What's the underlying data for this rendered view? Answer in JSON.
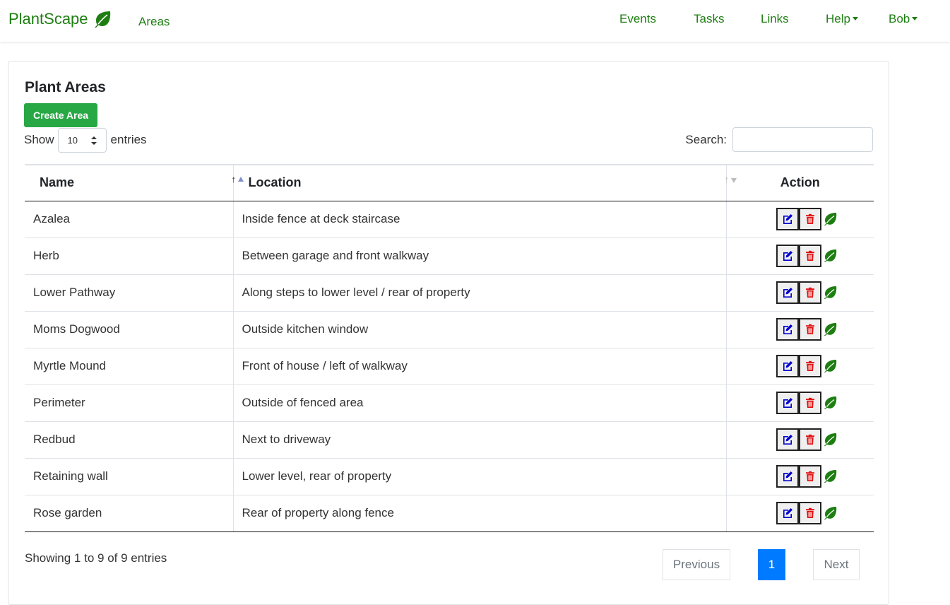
{
  "navbar": {
    "brand": "PlantScape",
    "areas": "Areas",
    "events": "Events",
    "tasks": "Tasks",
    "links": "Links",
    "help": "Help",
    "user": "Bob",
    "color": "#1e7e12"
  },
  "card": {
    "title": "Plant Areas",
    "create_button": "Create Area"
  },
  "length_menu": {
    "show": "Show",
    "value": "10",
    "entries": "entries"
  },
  "search": {
    "label": "Search:",
    "value": ""
  },
  "table": {
    "columns": [
      "Name",
      "Location",
      "Action"
    ],
    "sorted_column": "Name",
    "sort_direction": "ascending",
    "rows": [
      {
        "name": "Azalea",
        "location": "Inside fence at deck staircase"
      },
      {
        "name": "Herb",
        "location": "Between garage and front walkway"
      },
      {
        "name": "Lower Pathway",
        "location": "Along steps to lower level / rear of property"
      },
      {
        "name": "Moms Dogwood",
        "location": "Outside kitchen window"
      },
      {
        "name": "Myrtle Mound",
        "location": "Front of house / left of walkway"
      },
      {
        "name": "Perimeter",
        "location": "Outside of fenced area"
      },
      {
        "name": "Redbud",
        "location": "Next to driveway"
      },
      {
        "name": "Retaining wall",
        "location": "Lower level, rear of property"
      },
      {
        "name": "Rose garden",
        "location": "Rear of property along fence"
      }
    ],
    "action_icons": [
      "edit-icon",
      "trash-icon",
      "leaf-icon"
    ]
  },
  "footer": {
    "info": "Showing 1 to 9 of 9 entries",
    "previous": "Previous",
    "current_page": "1",
    "next": "Next"
  },
  "colors": {
    "brand": "#1e7e12",
    "create_button": "#28a745",
    "page_active": "#007bff",
    "edit_icon": "#0000cc",
    "trash_icon": "#e01010",
    "leaf_icon": "#1e7e12"
  }
}
